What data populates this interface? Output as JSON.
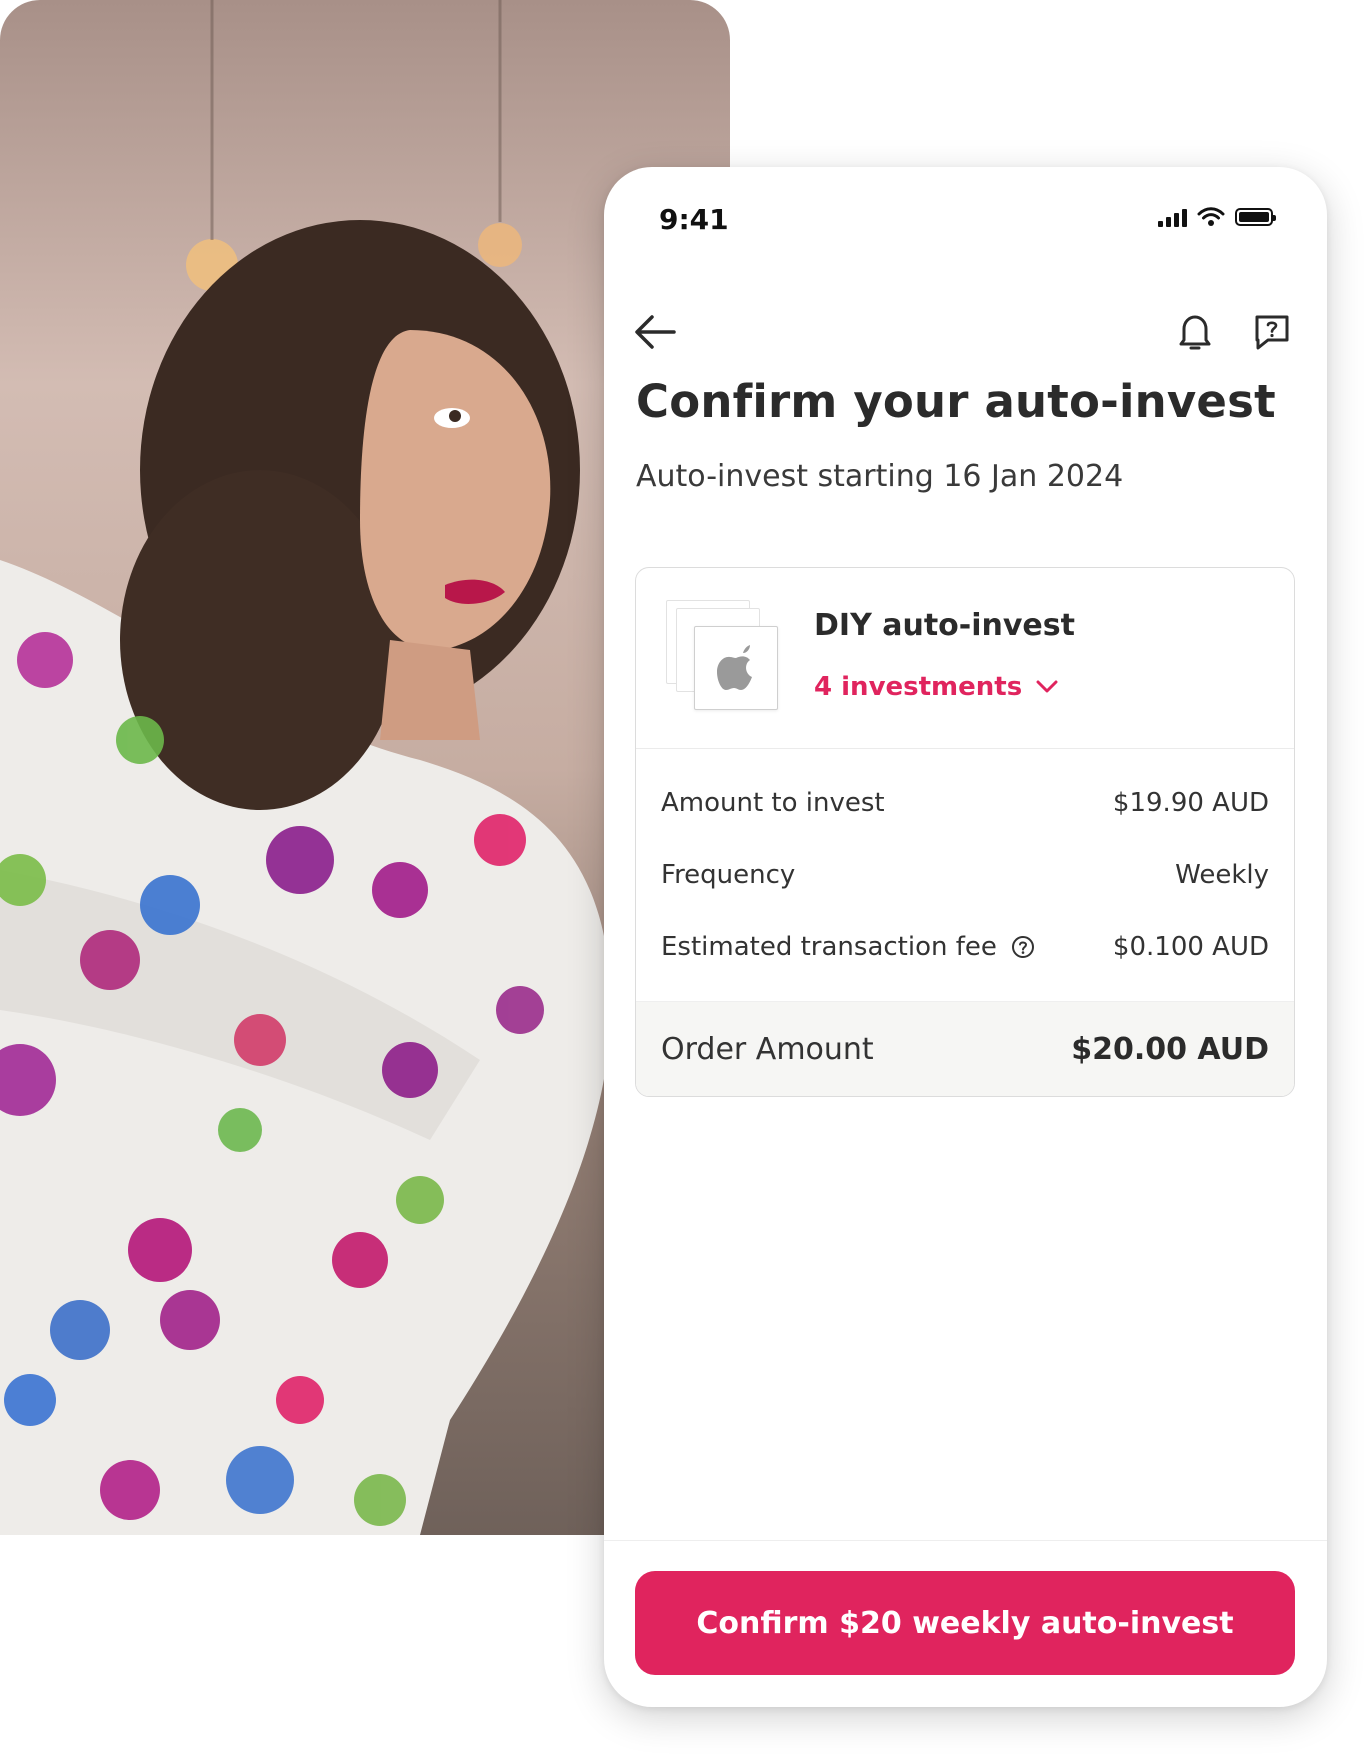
{
  "status_bar": {
    "time": "9:41"
  },
  "header": {
    "title": "Confirm your auto-invest",
    "subtitle": "Auto-invest starting 16 Jan 2024"
  },
  "icons": {
    "back": "arrow-left-icon",
    "notifications": "bell-icon",
    "help": "help-chat-icon",
    "logo": "apple-logo-icon",
    "info": "info-circle-icon",
    "chevron": "chevron-down-icon"
  },
  "card": {
    "title": "DIY auto-invest",
    "investments_label": "4 investments",
    "rows": [
      {
        "label": "Amount to invest",
        "value": "$19.90 AUD"
      },
      {
        "label": "Frequency",
        "value": "Weekly"
      },
      {
        "label": "Estimated transaction fee",
        "value": "$0.100 AUD"
      }
    ],
    "total": {
      "label": "Order Amount",
      "value": "$20.00 AUD"
    }
  },
  "cta": {
    "label": "Confirm $20 weekly auto-invest"
  },
  "colors": {
    "accent": "#e0245e",
    "text": "#2b2b2b",
    "total_bg": "#f6f6f4"
  }
}
